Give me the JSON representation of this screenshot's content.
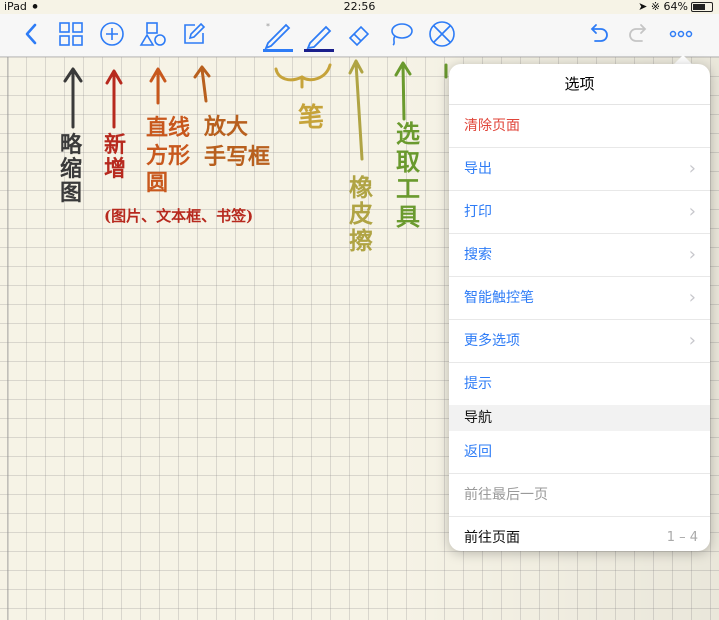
{
  "status_bar": {
    "device": "iPad",
    "time": "22:56",
    "battery": "64%",
    "battery_level": 0.64
  },
  "toolbar": {
    "icons": [
      "back-icon",
      "thumbnails-icon",
      "add-icon",
      "shapes-icon",
      "text-box-icon",
      "pen-icon",
      "highlighter-icon",
      "eraser-icon",
      "lasso-icon",
      "disable-touch-icon",
      "undo-icon",
      "redo-icon",
      "more-icon"
    ]
  },
  "annotations": {
    "thumbnails": "略\n缩\n图",
    "add": "新\n增",
    "add_note": "(图片、文本框、书签)",
    "shapes": "直线\n方形\n圆",
    "zoom": "放大\n手写框",
    "pen": "笔",
    "eraser": "橡\n皮\n擦",
    "lasso": "选\n取\n工\n具"
  },
  "annotation_colors": {
    "thumbnails": "#3a3a3a",
    "add": "#b7291e",
    "shapes": "#c8581d",
    "zoom": "#b8601e",
    "pen": "#c6a33a",
    "eraser": "#b0a444",
    "lasso": "#6a9a2e"
  },
  "menu": {
    "title": "选项",
    "items": [
      {
        "label": "清除页面"
      },
      {
        "label": "导出"
      },
      {
        "label": "打印"
      },
      {
        "label": "搜索"
      },
      {
        "label": "智能触控笔"
      },
      {
        "label": "更多选项"
      },
      {
        "label": "提示"
      }
    ],
    "nav_section": "导航",
    "nav_items": [
      {
        "label": "返回"
      },
      {
        "label": "前往最后一页"
      },
      {
        "label": "前往页面",
        "range": "1 – 4"
      }
    ]
  }
}
